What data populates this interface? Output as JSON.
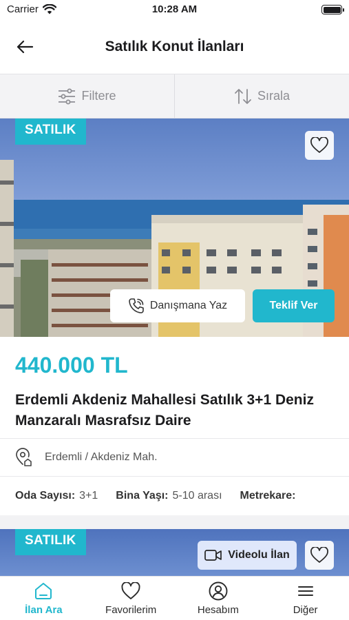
{
  "status_bar": {
    "carrier": "Carrier",
    "time": "10:28 AM"
  },
  "nav": {
    "title": "Satılık Konut İlanları"
  },
  "toolbar": {
    "filter_label": "Filtere",
    "sort_label": "Sırala"
  },
  "listings": [
    {
      "badge": "SATILIK",
      "consult_label": "Danışmana Yaz",
      "offer_label": "Teklif Ver",
      "price": "440.000 TL",
      "title": "Erdemli Akdeniz Mahallesi Satılık 3+1 Deniz Manzaralı Masrafsız Daire",
      "location": "Erdemli / Akdeniz Mah.",
      "specs": [
        {
          "label": "Oda Sayısı:",
          "value": "3+1"
        },
        {
          "label": "Bina Yaşı:",
          "value": "5-10 arası"
        },
        {
          "label": "Metrekare:",
          "value": ""
        }
      ]
    },
    {
      "badge": "SATILIK",
      "video_label": "Videolu İlan"
    }
  ],
  "tabs": [
    {
      "label": "İlan Ara",
      "icon": "home-icon",
      "active": true
    },
    {
      "label": "Favorilerim",
      "icon": "heart-icon",
      "active": false
    },
    {
      "label": "Hesabım",
      "icon": "user-icon",
      "active": false
    },
    {
      "label": "Diğer",
      "icon": "menu-icon",
      "active": false
    }
  ],
  "colors": {
    "accent": "#21b7cd",
    "text": "#1c1c1e",
    "muted": "#8e8e93"
  }
}
